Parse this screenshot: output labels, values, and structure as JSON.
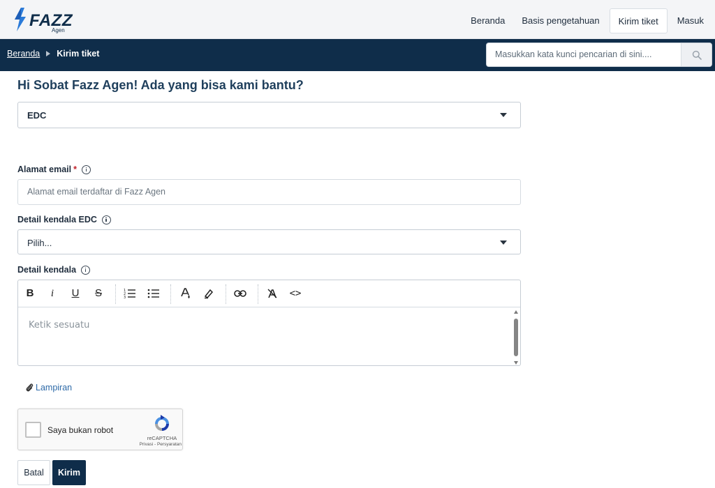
{
  "brand": {
    "name": "FAZZ",
    "sub": "Agen",
    "color": "#0f2d4a",
    "accent": "#2b7bd9"
  },
  "nav": {
    "items": [
      {
        "label": "Beranda"
      },
      {
        "label": "Basis pengetahuan"
      },
      {
        "label": "Kirim tiket",
        "active": true
      },
      {
        "label": "Masuk"
      }
    ]
  },
  "breadcrumb": {
    "home": "Beranda",
    "current": "Kirim tiket"
  },
  "search": {
    "placeholder": "Masukkan kata kunci pencarian di sini....",
    "icon": "search-icon"
  },
  "form": {
    "heading": "Hi Sobat Fazz Agen! Ada yang bisa kami bantu?",
    "category_value": "EDC",
    "email_label": "Alamat email",
    "email_required": "*",
    "email_placeholder": "Alamat email terdaftar di Fazz Agen",
    "detail_edc_label": "Detail kendala EDC",
    "detail_edc_value": "Pilih...",
    "detail_label": "Detail kendala",
    "editor_placeholder": "Ketik sesuatu",
    "toolbar": {
      "bold": "B",
      "italic": "i",
      "underline": "U",
      "strike": "S",
      "ordered_list": "ordered-list-icon",
      "bulleted_list": "bulleted-list-icon",
      "font_color": "font-color-icon",
      "highlight": "highlight-icon",
      "link": "link-icon",
      "clear_format": "clear-format-icon",
      "code": "<>"
    },
    "attachment_label": "Lampiran",
    "cancel_label": "Batal",
    "submit_label": "Kirim"
  },
  "captcha": {
    "label": "Saya bukan robot",
    "brand": "reCAPTCHA",
    "links": "Privasi - Persyaratan"
  },
  "colors": {
    "primary": "#0f2d4a",
    "link": "#2e6aa8",
    "required": "#c0202a"
  }
}
